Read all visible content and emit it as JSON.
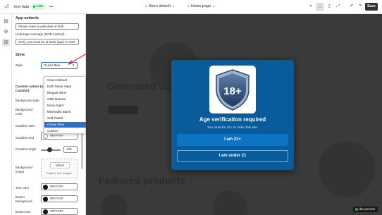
{
  "topbar": {
    "store_name": "test-data",
    "live_badge": "Live",
    "more": "•••",
    "store_select": "Store default",
    "page_select": "Home page",
    "save_label": "Save"
  },
  "panel": {
    "section_title": "App embeds",
    "dob_error_value": "Please enter a valid date of birth.",
    "underage_label": "Underage message (DOB method)",
    "underage_value": "Sorry, you must be at least (age) to enter",
    "style_heading": "Style",
    "style_label": "Style",
    "style_value": "Ocean Blue",
    "custom_colors_label_1": "Custom colors (use",
    "custom_colors_label_2": "Custom)",
    "bg_type_label": "Background type",
    "bg_color_label_1": "Background",
    "bg_color_label_2": "color",
    "gradient_start_label": "Gradient start",
    "gradient_end_label": "Gradient end",
    "gradient_end_value": "#FFFFFF",
    "gradient_angle_label": "Gradient angle",
    "gradient_angle_value": "135",
    "bg_image_label_1": "Background",
    "bg_image_label_2": "image",
    "select_button": "Select",
    "explore_link": "Explore free images",
    "text_color_label": "Text color",
    "text_color_value": "#FFFFFF",
    "button_bg_label_1": "Button",
    "button_bg_label_2": "background",
    "button_bg_value": "#FFFFFF",
    "button_text_label": "Button text",
    "button_text_value": "#FFFFFF"
  },
  "style_options": [
    "Clean Default",
    "Dark Mode Vape",
    "Elegant Wine",
    "CBD Natural",
    "Neon Night",
    "Minimalist Black",
    "Soft Pastel",
    "Ocean Blue",
    "Custom"
  ],
  "modal": {
    "badge_text": "18+",
    "title": "Age verification required",
    "subtitle": "You must be 21+ to enter this site.",
    "confirm_button": "I am 21+",
    "deny_button": "I am under 21"
  },
  "preview": {
    "ghost_heading": "Generated c",
    "ghost_heading_2": "Featured products"
  },
  "dev_chip": "dev preview",
  "colors": {
    "modal_bg": "#0a5b99",
    "accent": "#2c6ecb",
    "arrow": "#d9363e"
  },
  "icons": {
    "back": "exit-icon",
    "rail": [
      "sections-icon",
      "settings-gear-icon",
      "apps-icon"
    ],
    "devices": [
      "inspector-icon",
      "desktop-icon",
      "mobile-icon",
      "fullscreen-icon"
    ],
    "history": [
      "undo-icon",
      "redo-icon"
    ]
  }
}
